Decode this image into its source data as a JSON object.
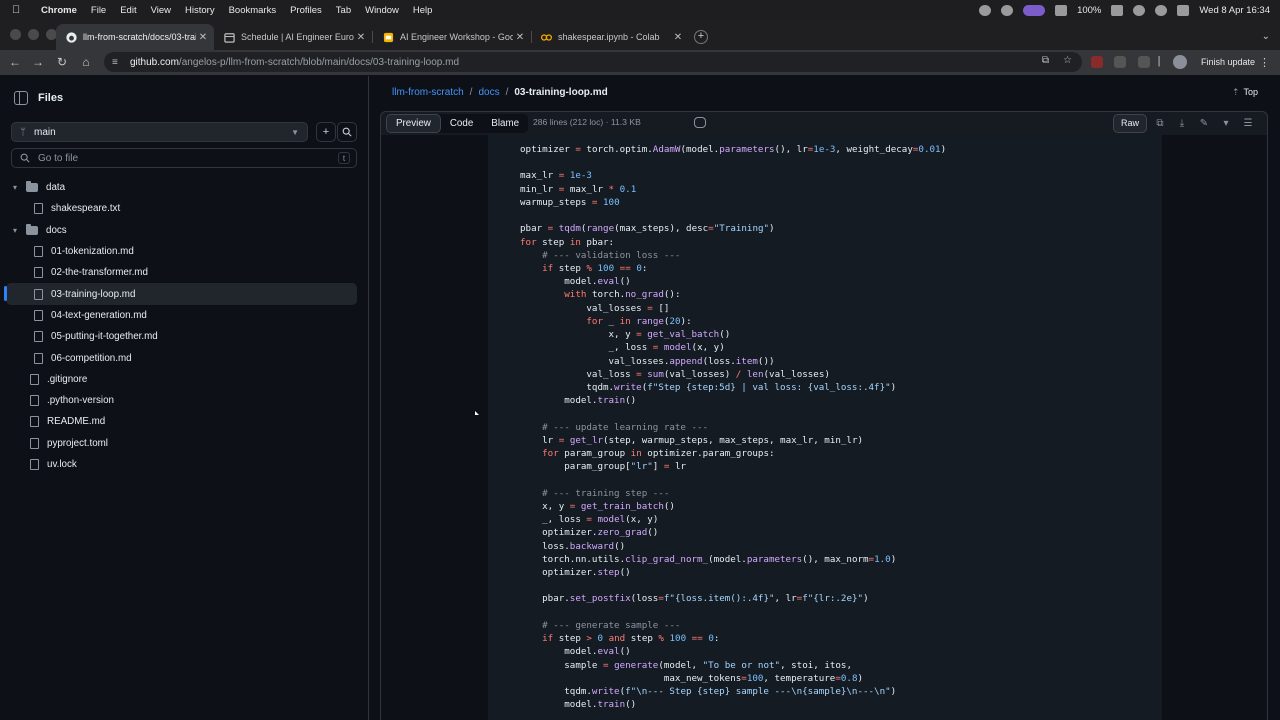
{
  "menubar": {
    "app": "Chrome",
    "items": [
      "File",
      "Edit",
      "View",
      "History",
      "Bookmarks",
      "Profiles",
      "Tab",
      "Window",
      "Help"
    ],
    "battery": "100%",
    "clock": "Wed 8 Apr  16:34"
  },
  "tabs": [
    {
      "title": "llm-from-scratch/docs/03-trai",
      "icon": "github-icon"
    },
    {
      "title": "Schedule | AI Engineer Europ",
      "icon": "calendar-icon"
    },
    {
      "title": "AI Engineer Workshop - Goog",
      "icon": "slides-icon"
    },
    {
      "title": "shakespear.ipynb - Colab",
      "icon": "colab-icon"
    }
  ],
  "address": {
    "host": "github.com",
    "path": "/angelos-p/llm-from-scratch/blob/main/docs/03-training-loop.md",
    "finish_update": "Finish update"
  },
  "sidebar": {
    "title": "Files",
    "branch": "main",
    "goto_placeholder": "Go to file",
    "goto_shortcut": "t",
    "tree": [
      {
        "type": "folder",
        "name": "data",
        "level": 0
      },
      {
        "type": "file",
        "name": "shakespeare.txt",
        "level": 1
      },
      {
        "type": "folder",
        "name": "docs",
        "level": 0
      },
      {
        "type": "file",
        "name": "01-tokenization.md",
        "level": 1
      },
      {
        "type": "file",
        "name": "02-the-transformer.md",
        "level": 1
      },
      {
        "type": "file",
        "name": "03-training-loop.md",
        "level": 1,
        "selected": true
      },
      {
        "type": "file",
        "name": "04-text-generation.md",
        "level": 1
      },
      {
        "type": "file",
        "name": "05-putting-it-together.md",
        "level": 1
      },
      {
        "type": "file",
        "name": "06-competition.md",
        "level": 1
      },
      {
        "type": "file",
        "name": ".gitignore",
        "level": 0
      },
      {
        "type": "file",
        "name": ".python-version",
        "level": 0
      },
      {
        "type": "file",
        "name": "README.md",
        "level": 0
      },
      {
        "type": "file",
        "name": "pyproject.toml",
        "level": 0
      },
      {
        "type": "file",
        "name": "uv.lock",
        "level": 0
      }
    ]
  },
  "breadcrumb": {
    "repo": "llm-from-scratch",
    "folder": "docs",
    "file": "03-training-loop.md",
    "top": "Top"
  },
  "filebar": {
    "tabs": [
      "Preview",
      "Code",
      "Blame"
    ],
    "active_tab": "Preview",
    "info": "286 lines (212 loc) · 11.3 KB",
    "raw": "Raw"
  },
  "code_lines": [
    "optimizer = torch.optim.AdamW(model.parameters(), lr=1e-3, weight_decay=0.01)",
    "",
    "max_lr = 1e-3",
    "min_lr = max_lr * 0.1",
    "warmup_steps = 100",
    "",
    "pbar = tqdm(range(max_steps), desc=\"Training\")",
    "for step in pbar:",
    "    # --- validation loss ---",
    "    if step % 100 == 0:",
    "        model.eval()",
    "        with torch.no_grad():",
    "            val_losses = []",
    "            for _ in range(20):",
    "                x, y = get_val_batch()",
    "                _, loss = model(x, y)",
    "                val_losses.append(loss.item())",
    "            val_loss = sum(val_losses) / len(val_losses)",
    "            tqdm.write(f\"Step {step:5d} | val loss: {val_loss:.4f}\")",
    "        model.train()",
    "",
    "    # --- update learning rate ---",
    "    lr = get_lr(step, warmup_steps, max_steps, max_lr, min_lr)",
    "    for param_group in optimizer.param_groups:",
    "        param_group[\"lr\"] = lr",
    "",
    "    # --- training step ---",
    "    x, y = get_train_batch()",
    "    _, loss = model(x, y)",
    "    optimizer.zero_grad()",
    "    loss.backward()",
    "    torch.nn.utils.clip_grad_norm_(model.parameters(), max_norm=1.0)",
    "    optimizer.step()",
    "",
    "    pbar.set_postfix(loss=f\"{loss.item():.4f}\", lr=f\"{lr:.2e}\")",
    "",
    "    # --- generate sample ---",
    "    if step > 0 and step % 100 == 0:",
    "        model.eval()",
    "        sample = generate(model, \"To be or not\", stoi, itos,",
    "                          max_new_tokens=100, temperature=0.8)",
    "        tqdm.write(f\"\\n--- Step {step} sample ---\\n{sample}\\n---\\n\")",
    "        model.train()"
  ]
}
